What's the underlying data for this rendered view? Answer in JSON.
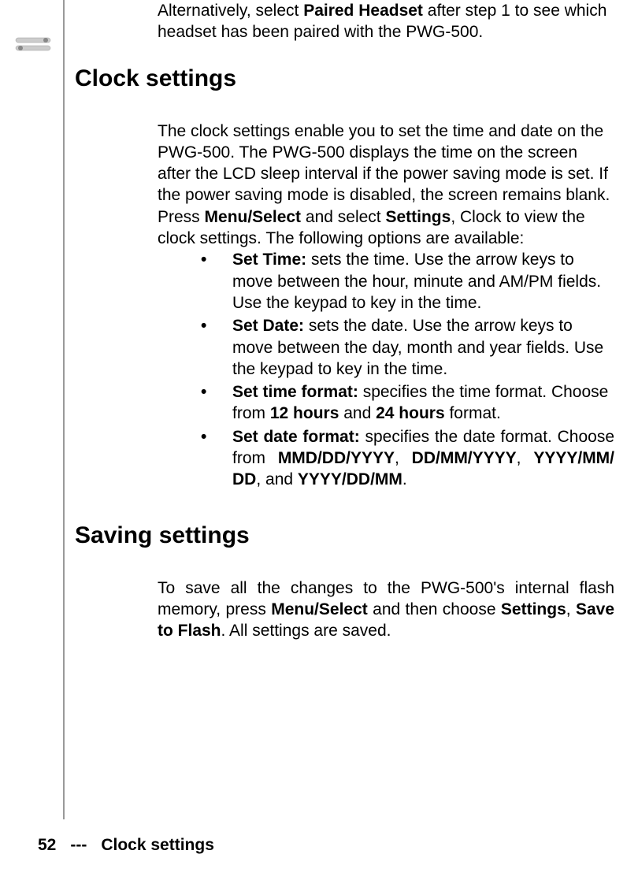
{
  "intro": {
    "pre": "Alternatively, select ",
    "bold1": "Paired Headset",
    "post": " after step 1 to see which headset has been paired with the PWG-500."
  },
  "clock": {
    "heading": "Clock settings",
    "para_pre": "The clock settings enable you to set the time and date on the PWG-500. The PWG-500 displays the time on the screen after the LCD sleep interval if the power saving mode is set. If the power saving mode is disabled, the screen remains blank. Press ",
    "para_b1": "Menu/Select",
    "para_mid1": " and select ",
    "para_b2": "Set­tings",
    "para_mid2": ", Clock to view the clock settings. The following options are available:",
    "items": [
      {
        "lead_b": "Set Time:",
        "rest": " sets the time. Use the arrow keys to move between the hour, minute and AM/PM fields. Use the keypad to key in the time."
      },
      {
        "lead_b": "Set Date:",
        "rest": " sets the date. Use the arrow keys to move between the day, month and year fields. Use the keypad to key in the time."
      },
      {
        "lead_b": "Set time format:",
        "rest_pre": " specifies the time format. Choose from ",
        "b1": "12 hours",
        "mid1": " and ",
        "b2": "24 hours",
        "rest_post": " format."
      },
      {
        "lead_b": "Set date format:",
        "rest_pre": " specifies the date format. Choose from ",
        "b1": "MMD/DD/YYYY",
        "mid1": ", ",
        "b2": "DD/MM/YYYY",
        "mid2": ", ",
        "b3": "YYYY/MM/ DD",
        "mid3": ", and ",
        "b4": "YYYY/DD/MM",
        "rest_post": "."
      }
    ]
  },
  "saving": {
    "heading": "Saving settings",
    "para_pre": "To save all the changes to the PWG-500's internal flash memory, press ",
    "b1": "Menu/Select",
    "mid1": " and then choose ",
    "b2": "Settings",
    "mid2": ", ",
    "b3": "Save to Flash",
    "post": ". All settings are saved."
  },
  "footer": {
    "page": "52",
    "sep": "---",
    "title": "Clock settings"
  }
}
